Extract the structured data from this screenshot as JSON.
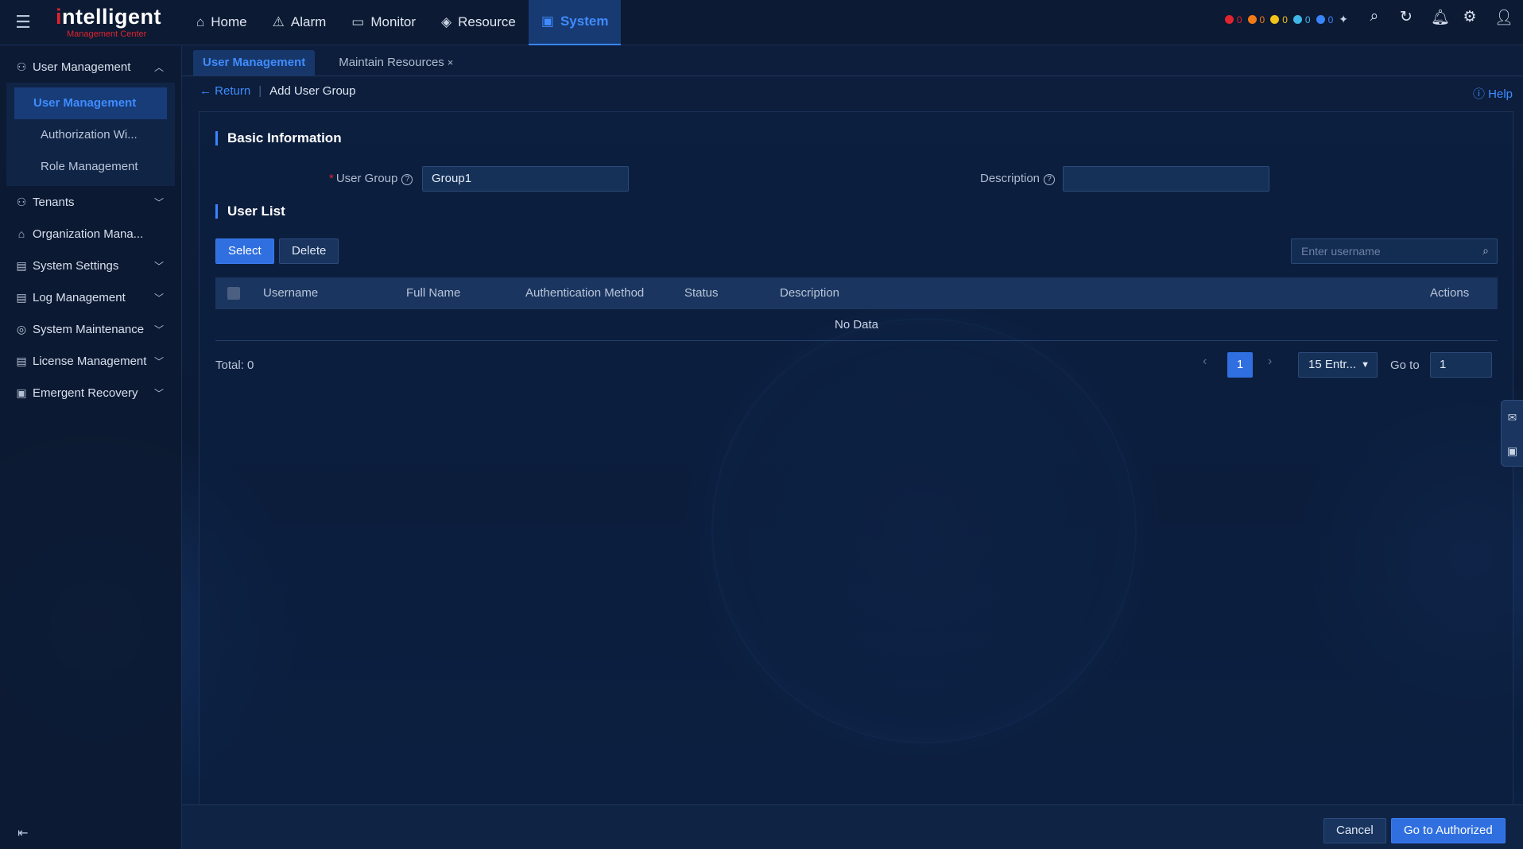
{
  "app": {
    "brand_prefix": "i",
    "brand_rest": "ntelligent",
    "brand_sub": "Management Center"
  },
  "nav": {
    "items": [
      {
        "label": "Home",
        "icon": "home-icon"
      },
      {
        "label": "Alarm",
        "icon": "warning-icon"
      },
      {
        "label": "Monitor",
        "icon": "monitor-icon"
      },
      {
        "label": "Resource",
        "icon": "layers-icon"
      },
      {
        "label": "System",
        "icon": "system-icon",
        "active": true
      }
    ]
  },
  "alarm_counts": [
    {
      "color": "#e0242f",
      "count": "0"
    },
    {
      "color": "#f07a18",
      "count": "0"
    },
    {
      "color": "#f2c417",
      "count": "0"
    },
    {
      "color": "#3fb7e8",
      "count": "0"
    },
    {
      "color": "#3a85ff",
      "count": "0"
    }
  ],
  "sidebar": {
    "groups": [
      {
        "label": "User Management",
        "expanded": true,
        "icon": "user-icon"
      },
      {
        "label": "Tenants",
        "icon": "tenant-icon"
      },
      {
        "label": "Organization Mana...",
        "icon": "organization-icon"
      },
      {
        "label": "System Settings",
        "icon": "settings-icon"
      },
      {
        "label": "Log Management",
        "icon": "log-icon"
      },
      {
        "label": "System Maintenance",
        "icon": "maintenance-icon"
      },
      {
        "label": "License Management",
        "icon": "license-icon"
      },
      {
        "label": "Emergent Recovery",
        "icon": "recovery-icon"
      }
    ],
    "sub_items": [
      {
        "label": "User Management",
        "active": true
      },
      {
        "label": "Authorization Wi..."
      },
      {
        "label": "Role Management"
      }
    ]
  },
  "tabs": [
    {
      "label": "User Management",
      "active": true
    },
    {
      "label": "Maintain Resources",
      "close": "×"
    }
  ],
  "breadcrumb": {
    "return_label": "Return",
    "separator": "|",
    "current": "Add User Group"
  },
  "help_label": "Help",
  "basic_info": {
    "title": "Basic Information",
    "user_group_label": "User Group",
    "user_group_value": "Group1",
    "required_mark": "*",
    "description_label": "Description",
    "description_value": ""
  },
  "user_list": {
    "title": "User List",
    "select_label": "Select",
    "delete_label": "Delete",
    "search_placeholder": "Enter username",
    "columns": [
      "Username",
      "Full Name",
      "Authentication Method",
      "Status",
      "Description",
      "Actions"
    ],
    "empty_text": "No Data",
    "total_label": "Total: 0",
    "current_page": "1",
    "page_size": "15 Entr...",
    "goto_label": "Go to",
    "goto_value": "1"
  },
  "footer": {
    "cancel_label": "Cancel",
    "primary_label": "Go to Authorized"
  }
}
